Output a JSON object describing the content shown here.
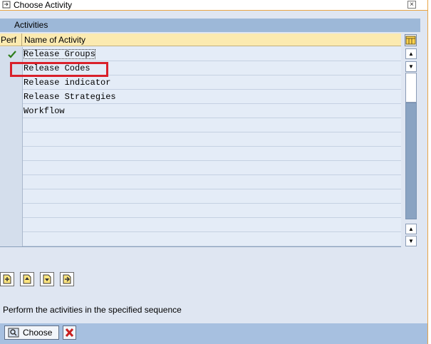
{
  "window": {
    "title": "Choose Activity"
  },
  "table": {
    "title": "Activities",
    "columns": {
      "perf": "Perf",
      "name": "Name of Activity"
    },
    "rows": [
      {
        "name": "Release Groups",
        "performed": true
      },
      {
        "name": "Release Codes",
        "performed": false
      },
      {
        "name": "Release indicator",
        "performed": false
      },
      {
        "name": "Release Strategies",
        "performed": false
      },
      {
        "name": "Workflow",
        "performed": false
      },
      {
        "name": "",
        "performed": false
      },
      {
        "name": "",
        "performed": false
      },
      {
        "name": "",
        "performed": false
      },
      {
        "name": "",
        "performed": false
      },
      {
        "name": "",
        "performed": false
      },
      {
        "name": "",
        "performed": false
      },
      {
        "name": "",
        "performed": false
      },
      {
        "name": "",
        "performed": false
      },
      {
        "name": "",
        "performed": false
      }
    ]
  },
  "instruction": "Perform the activities in the specified sequence",
  "footer": {
    "choose_label": "Choose"
  },
  "colors": {
    "highlight": "#d9202a",
    "header_band": "#9db8d8",
    "footer": "#a7c0e0"
  }
}
